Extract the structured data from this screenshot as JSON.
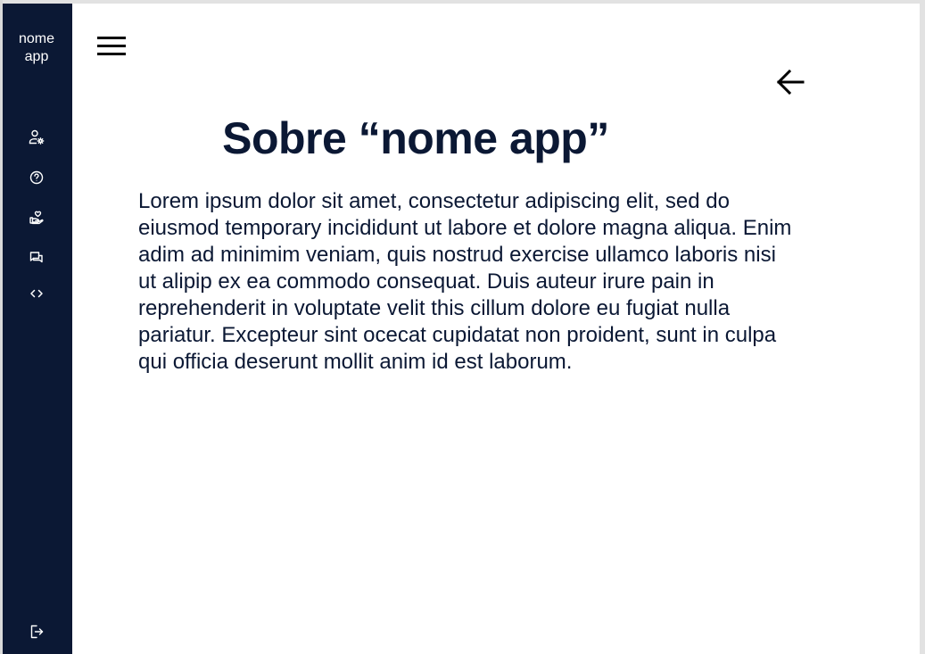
{
  "app": {
    "name_line1": "nome",
    "name_line2": "app"
  },
  "sidebar": {
    "items": [
      {
        "icon": "user-settings-icon"
      },
      {
        "icon": "help-circle-icon"
      },
      {
        "icon": "donate-heart-hand-icon"
      },
      {
        "icon": "chat-messages-icon"
      },
      {
        "icon": "code-brackets-icon"
      }
    ],
    "footer": {
      "icon": "logout-icon"
    }
  },
  "header": {
    "menu_icon": "hamburger-menu-icon",
    "back_icon": "arrow-left-icon"
  },
  "main": {
    "title": "Sobre “nome app”",
    "body": "Lorem ipsum dolor sit amet, consectetur adipiscing elit, sed do eiusmod temporary incididunt ut labore et dolore magna aliqua. Enim adim ad minimim veniam, quis nostrud exercise ullamco laboris nisi ut alipip ex ea commodo consequat. Duis auteur irure pain in reprehenderit in voluptate velit this cillum dolore eu fugiat nulla pariatur. Excepteur sint ocecat cupidatat non proident, sunt in culpa qui officia deserunt mollit anim id est laborum."
  },
  "colors": {
    "sidebar_bg": "#0b1834",
    "text_primary": "#0b1834",
    "icon_light": "#ffffff"
  }
}
